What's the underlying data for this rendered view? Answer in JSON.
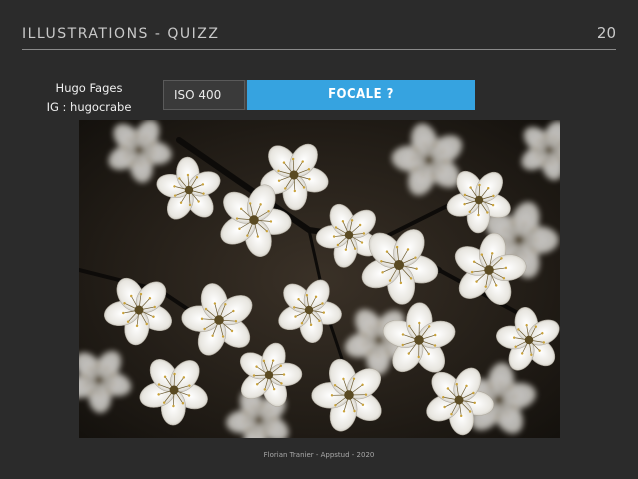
{
  "header": {
    "title": "ILLUSTRATIONS - QUIZZ",
    "page_number": "20"
  },
  "credit": {
    "name": "Hugo Fages",
    "instagram": "IG : hugocrabe"
  },
  "settings": {
    "iso_label": "ISO 400",
    "focal_label": "FOCALE ?"
  },
  "photo": {
    "subject": "white-blossom-flowers"
  },
  "footer": {
    "text": "Florian Tranier - Appstud - 2020"
  },
  "colors": {
    "background": "#2b2b2b",
    "accent": "#36a3e0",
    "text": "#c9c9c9"
  }
}
